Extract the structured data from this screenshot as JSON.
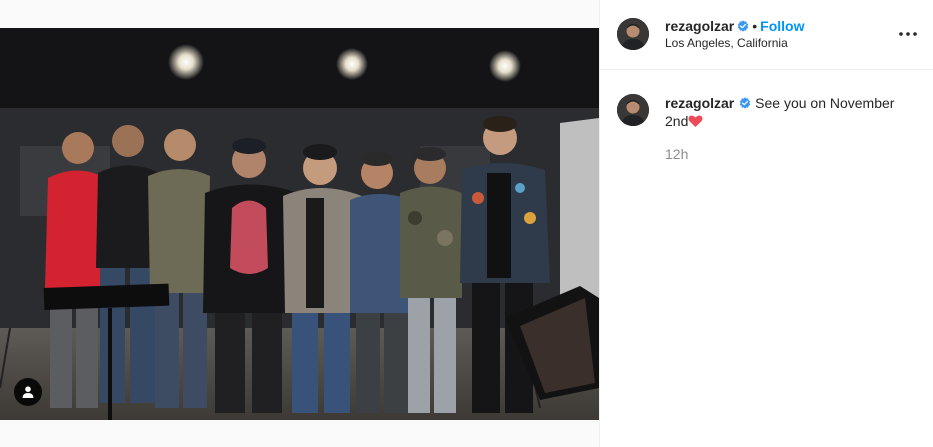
{
  "post": {
    "author": {
      "username": "rezagolzar",
      "verified": true,
      "avatar_icon": "profile-avatar"
    },
    "follow_label": "Follow",
    "separator": "•",
    "location": "Los Angeles, California",
    "more_icon": "more-options-icon",
    "tag_icon": "user-tag-icon",
    "caption": {
      "text_part1": "See you on November",
      "text_part2": "2nd",
      "emoji": "red-heart"
    },
    "time_ago": "12h"
  },
  "colors": {
    "link_blue": "#0095f6",
    "verified_blue": "#3897f0",
    "text": "#262626",
    "muted": "#8e8e8e",
    "heart_red": "#ed4956"
  }
}
